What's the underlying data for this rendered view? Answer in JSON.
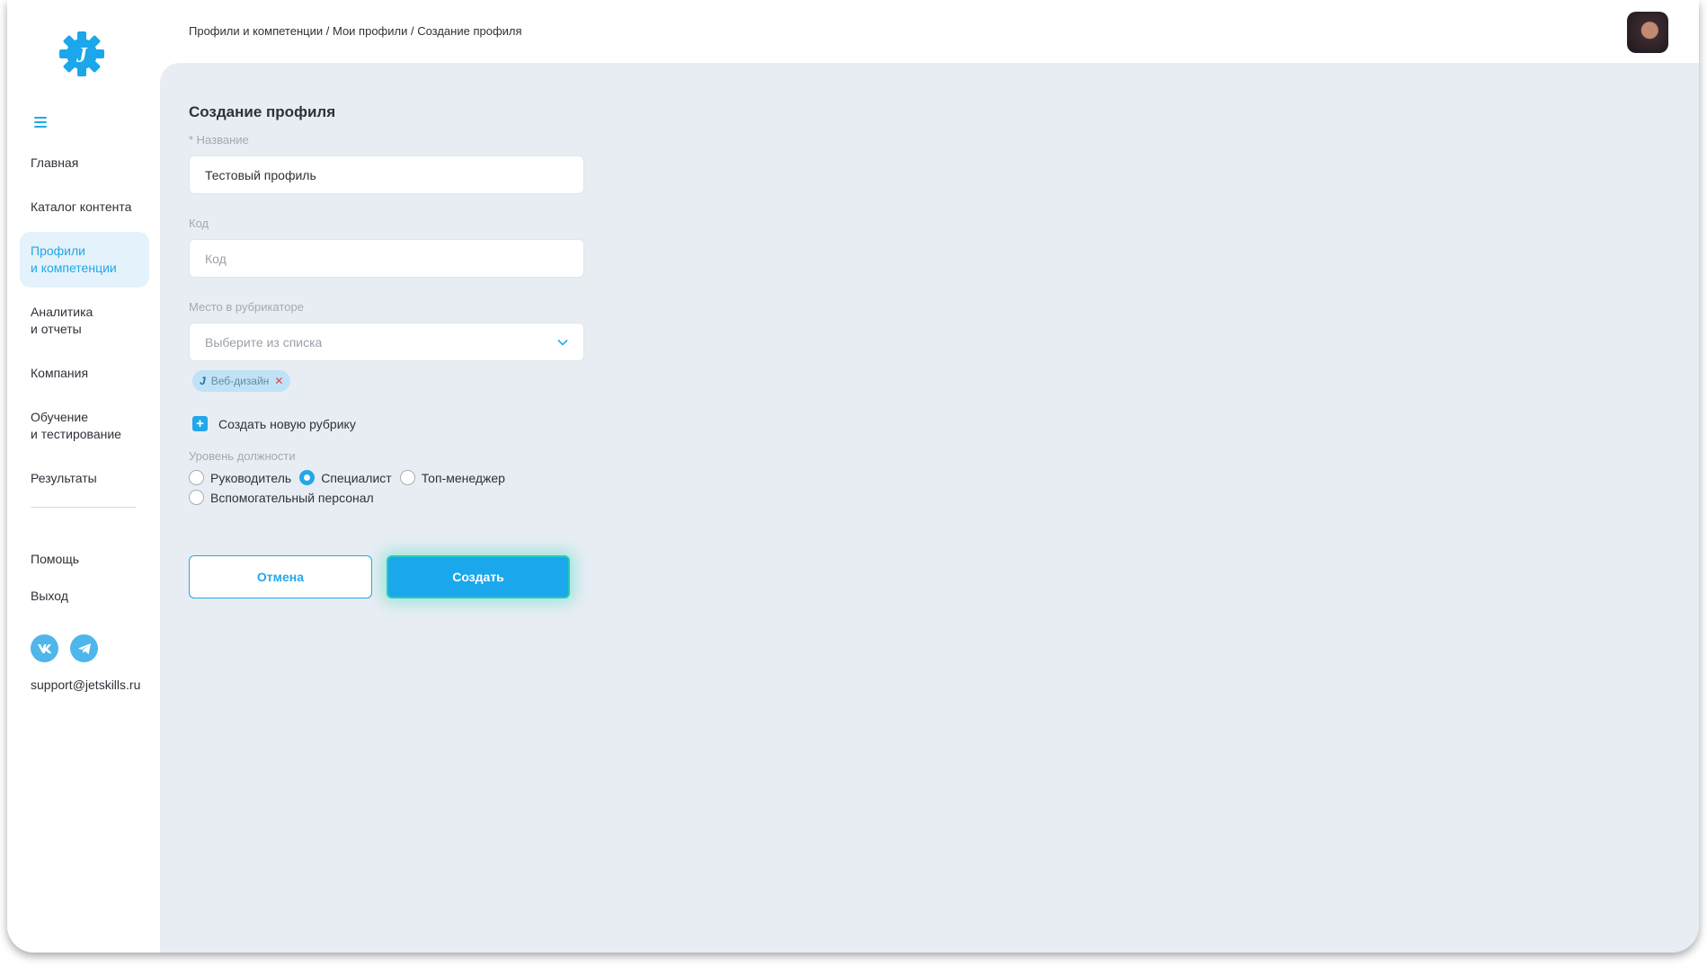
{
  "breadcrumb": {
    "part1": "Профили и компетенции",
    "sep": " / ",
    "part2": "Мои профили",
    "part3": "Создание профиля"
  },
  "sidebar": {
    "items": [
      {
        "label": "Главная"
      },
      {
        "label": "Каталог контента"
      },
      {
        "label": "Профили\nи компетенции"
      },
      {
        "label": "Аналитика\nи отчеты"
      },
      {
        "label": "Компания"
      },
      {
        "label": "Обучение\nи тестирование"
      },
      {
        "label": "Результаты"
      }
    ],
    "help": "Помощь",
    "logout": "Выход",
    "email": "support@jetskills.ru"
  },
  "form": {
    "title": "Создание профиля",
    "name_label": "* Название",
    "name_value": "Тестовый профиль",
    "code_label": "Код",
    "code_placeholder": "Код",
    "category_label": "Место в рубрикаторе",
    "category_placeholder": "Выберите из списка",
    "chip_icon": "J",
    "chip_label": "Веб-дизайн",
    "new_category": "Создать новую рубрику",
    "level_label": "Уровень должности",
    "levels": [
      "Руководитель",
      "Специалист",
      "Топ-менеджер",
      "Вспомогательный персонал"
    ],
    "selected_level": "Специалист"
  },
  "buttons": {
    "cancel": "Отмена",
    "create": "Создать"
  },
  "icons": {
    "logo": "gear-logo-icon",
    "menu": "hamburger-icon",
    "chevron": "chevron-down-icon",
    "vk": "vk-icon",
    "telegram": "telegram-icon"
  },
  "colors": {
    "accent": "#23a7e8",
    "content_bg": "#e8edf4",
    "active_nav_bg": "#e3f2fb"
  }
}
